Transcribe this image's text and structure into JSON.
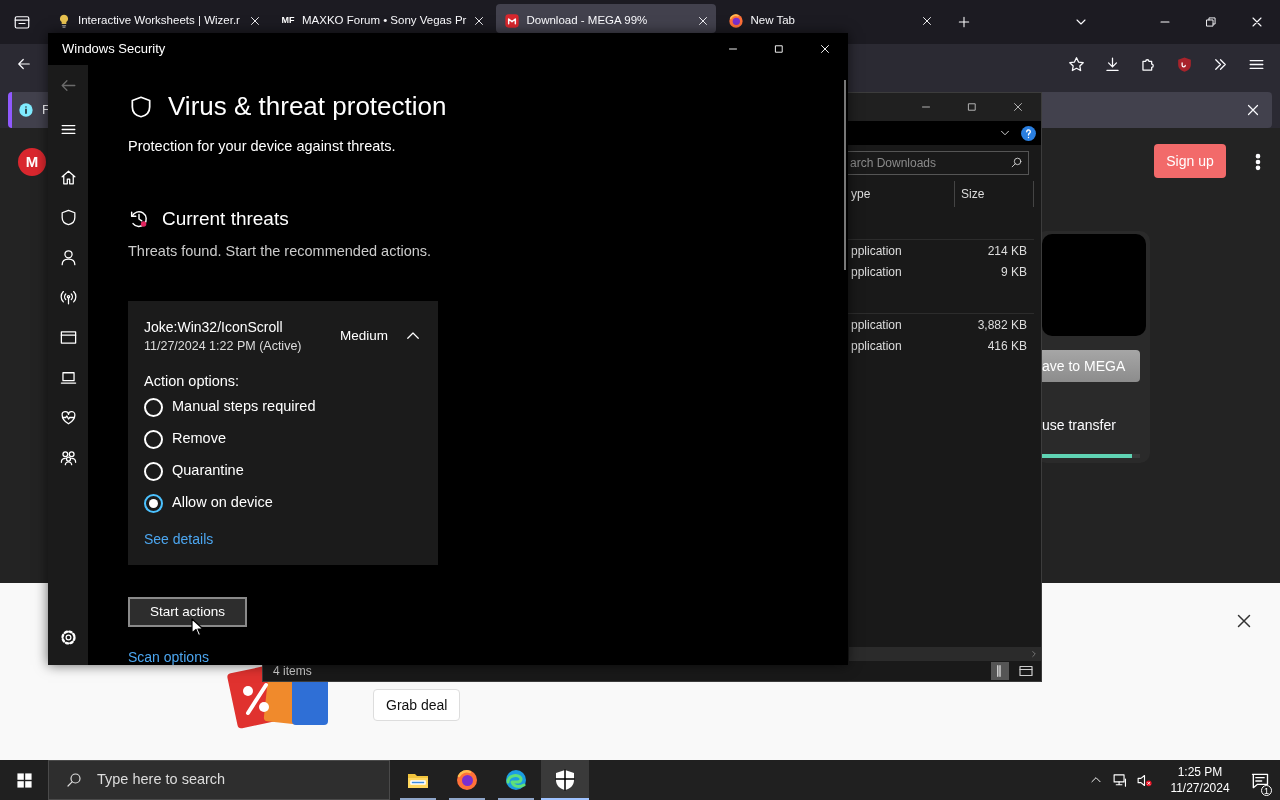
{
  "browser": {
    "tabs": [
      {
        "label": "Interactive Worksheets | Wizer.r",
        "kind": "bulb",
        "selected": false
      },
      {
        "label": "MAXKO Forum • Sony Vegas Pr",
        "kind": "mf",
        "icon_text": "MF",
        "selected": false
      },
      {
        "label": "Download - MEGA 99%",
        "kind": "mega",
        "selected": true
      },
      {
        "label": "New Tab",
        "kind": "firefox",
        "selected": false
      }
    ],
    "notification": {
      "text": "F"
    },
    "page": {
      "logo": "M",
      "sign_up": "Sign up",
      "save_button": "ave to MEGA",
      "transfer_label": "use transfer",
      "transfer": {
        "level": 0.92
      }
    },
    "ad": {
      "button": "Grab deal"
    }
  },
  "explorer": {
    "search": {
      "placeholder": "arch Downloads"
    },
    "columns": [
      "ype",
      "Size"
    ],
    "groups": [
      {
        "rows": [
          {
            "type": "pplication",
            "size": "214 KB"
          },
          {
            "type": "pplication",
            "size": "9 KB"
          }
        ]
      },
      {
        "rows": [
          {
            "type": "pplication",
            "size": "3,882 KB"
          },
          {
            "type": "pplication",
            "size": "416 KB"
          }
        ]
      }
    ],
    "status": "4 items"
  },
  "security": {
    "title": "Windows Security",
    "nav": [
      {
        "kind": "back",
        "disabled": true
      },
      {
        "kind": "menu",
        "disabled": false
      },
      {
        "kind": "home",
        "disabled": false
      },
      {
        "kind": "shield",
        "disabled": false
      },
      {
        "kind": "account",
        "disabled": false
      },
      {
        "kind": "network",
        "disabled": false
      },
      {
        "kind": "app",
        "disabled": false
      },
      {
        "kind": "device",
        "disabled": false
      },
      {
        "kind": "health",
        "disabled": false
      },
      {
        "kind": "family",
        "disabled": false
      }
    ],
    "nav_bottom": [
      {
        "kind": "settings",
        "disabled": false
      }
    ],
    "heading": "Virus & threat protection",
    "subtitle": "Protection for your device against threats.",
    "section": {
      "title": "Current threats",
      "text": "Threats found. Start the recommended actions."
    },
    "threat": {
      "name": "Joke:Win32/IconScroll",
      "date": "11/27/2024 1:22 PM (Active)",
      "severity": "Medium",
      "expanded": true,
      "options_label": "Action options:",
      "options": [
        {
          "label": "Manual steps required",
          "selected": false
        },
        {
          "label": "Remove",
          "selected": false
        },
        {
          "label": "Quarantine",
          "selected": false
        },
        {
          "label": "Allow on device",
          "selected": true
        }
      ],
      "details_link": "See details"
    },
    "start_button": "Start actions",
    "scan_link": "Scan options"
  },
  "taskbar": {
    "search": {
      "placeholder": "Type here to search"
    },
    "apps": [
      {
        "kind": "explorer",
        "selected": false
      },
      {
        "kind": "firefox",
        "selected": false
      },
      {
        "kind": "edge",
        "selected": false
      },
      {
        "kind": "security",
        "selected": true
      }
    ],
    "time": "1:25 PM",
    "date": "11/27/2024",
    "notifications": "1"
  }
}
